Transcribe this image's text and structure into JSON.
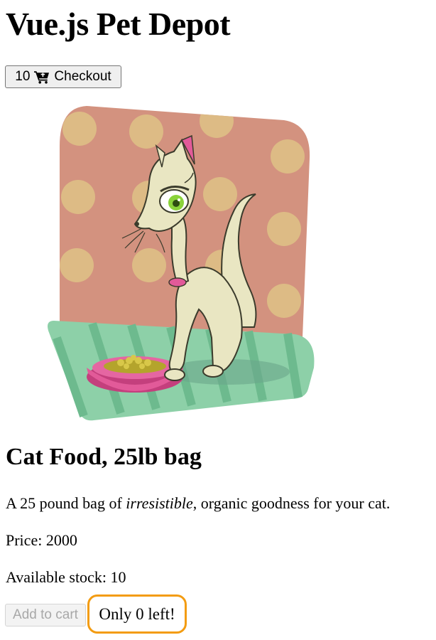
{
  "header": {
    "title": "Vue.js Pet Depot",
    "cart_count": "10",
    "checkout_label": "Checkout",
    "cart_icon": "shopping-cart-icon"
  },
  "product": {
    "image_subject": "cartoon cat with food bowl",
    "title": "Cat Food, 25lb bag",
    "description": {
      "prefix": "A 25 pound bag of ",
      "emphasis": "irresistible",
      "suffix": ", organic goodness for your cat."
    },
    "price_label": "Price:",
    "price": "2000",
    "stock_label": "Available stock:",
    "stock": "10"
  },
  "actions": {
    "add_to_cart_label": "Add to cart",
    "add_to_cart_disabled": true,
    "low_stock_message": "Only 0 left!"
  },
  "colors": {
    "highlight_border": "#f39c12"
  }
}
